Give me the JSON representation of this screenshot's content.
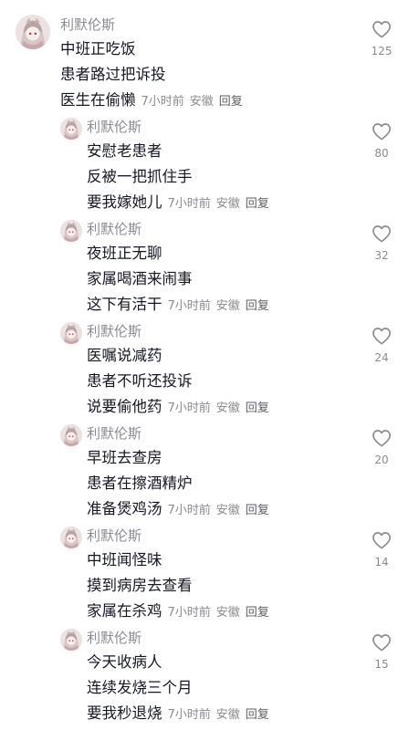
{
  "comments": [
    {
      "username": "利默伦斯",
      "lines": [
        "中班正吃饭",
        "患者路过把诉投",
        "医生在偷懒"
      ],
      "time": "7小时前",
      "location": "安徽",
      "reply": "回复",
      "likes": "125"
    },
    {
      "username": "利默伦斯",
      "lines": [
        "安慰老患者",
        "反被一把抓住手",
        "要我嫁她儿"
      ],
      "time": "7小时前",
      "location": "安徽",
      "reply": "回复",
      "likes": "80"
    },
    {
      "username": "利默伦斯",
      "lines": [
        "夜班正无聊",
        "家属喝酒来闹事",
        "这下有活干"
      ],
      "time": "7小时前",
      "location": "安徽",
      "reply": "回复",
      "likes": "32"
    },
    {
      "username": "利默伦斯",
      "lines": [
        "医嘱说减药",
        "患者不听还投诉",
        "说要偷他药"
      ],
      "time": "7小时前",
      "location": "安徽",
      "reply": "回复",
      "likes": "24"
    },
    {
      "username": "利默伦斯",
      "lines": [
        "早班去查房",
        "患者在擦酒精炉",
        "准备煲鸡汤"
      ],
      "time": "7小时前",
      "location": "安徽",
      "reply": "回复",
      "likes": "20"
    },
    {
      "username": "利默伦斯",
      "lines": [
        "中班闻怪味",
        "摸到病房去查看",
        "家属在杀鸡"
      ],
      "time": "7小时前",
      "location": "安徽",
      "reply": "回复",
      "likes": "14"
    },
    {
      "username": "利默伦斯",
      "lines": [
        "今天收病人",
        "连续发烧三个月",
        "要我秒退烧"
      ],
      "time": "7小时前",
      "location": "安徽",
      "reply": "回复",
      "likes": "15"
    }
  ],
  "icons": {
    "avatar": "anime-avatar-icon",
    "like": "heart-outline-icon"
  },
  "colors": {
    "text": "#161823",
    "secondary": "#8a8b91"
  }
}
